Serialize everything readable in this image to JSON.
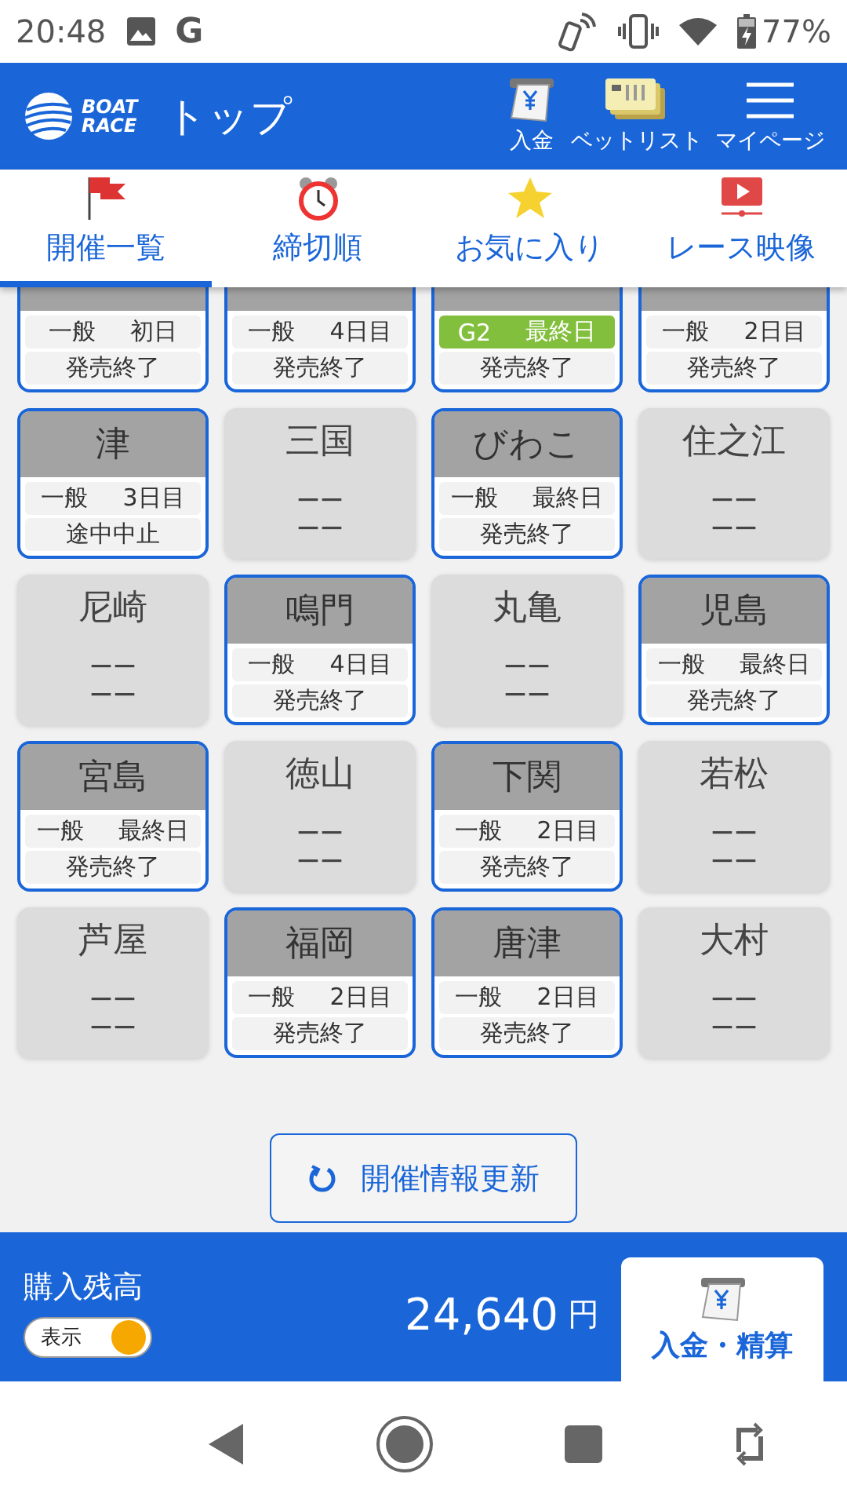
{
  "status_bar": {
    "time": "20:48",
    "app_letter": "G",
    "battery": "77%"
  },
  "header": {
    "logo": [
      "BOAT",
      "RACE"
    ],
    "title": "トップ",
    "actions": [
      {
        "kind": "deposit",
        "label": "入金"
      },
      {
        "kind": "betlist",
        "label": "ベットリスト"
      },
      {
        "kind": "menu",
        "label": "マイページ"
      }
    ]
  },
  "tabs": [
    {
      "kind": "flag",
      "label": "開催一覧",
      "selected": true
    },
    {
      "kind": "clock",
      "label": "締切順",
      "selected": false
    },
    {
      "kind": "star",
      "label": "お気に入り",
      "selected": false
    },
    {
      "kind": "video",
      "label": "レース映像",
      "selected": false
    }
  ],
  "venues": [
    {
      "kind": "open",
      "grade": "一般",
      "day": "初日",
      "status": "発売終了",
      "highlight": false
    },
    {
      "kind": "open",
      "grade": "一般",
      "day": "4日目",
      "status": "発売終了",
      "highlight": false
    },
    {
      "kind": "open",
      "grade": "G2",
      "day": "最終日",
      "status": "発売終了",
      "highlight": true
    },
    {
      "kind": "open",
      "grade": "一般",
      "day": "2日目",
      "status": "発売終了",
      "highlight": false
    },
    {
      "kind": "open",
      "name": "津",
      "grade": "一般",
      "day": "3日目",
      "status": "途中中止",
      "highlight": false
    },
    {
      "kind": "closed",
      "name": "三国",
      "lines": [
        "ーー",
        "ーー"
      ]
    },
    {
      "kind": "open",
      "name": "びわこ",
      "grade": "一般",
      "day": "最終日",
      "status": "発売終了",
      "highlight": false
    },
    {
      "kind": "closed",
      "name": "住之江",
      "lines": [
        "ーー",
        "ーー"
      ]
    },
    {
      "kind": "closed",
      "name": "尼崎",
      "lines": [
        "ーー",
        "ーー"
      ]
    },
    {
      "kind": "open",
      "name": "鳴門",
      "grade": "一般",
      "day": "4日目",
      "status": "発売終了",
      "highlight": false
    },
    {
      "kind": "closed",
      "name": "丸亀",
      "lines": [
        "ーー",
        "ーー"
      ]
    },
    {
      "kind": "open",
      "name": "児島",
      "grade": "一般",
      "day": "最終日",
      "status": "発売終了",
      "highlight": false
    },
    {
      "kind": "open",
      "name": "宮島",
      "grade": "一般",
      "day": "最終日",
      "status": "発売終了",
      "highlight": false
    },
    {
      "kind": "closed",
      "name": "徳山",
      "lines": [
        "ーー",
        "ーー"
      ]
    },
    {
      "kind": "open",
      "name": "下関",
      "grade": "一般",
      "day": "2日目",
      "status": "発売終了",
      "highlight": false
    },
    {
      "kind": "closed",
      "name": "若松",
      "lines": [
        "ーー",
        "ーー"
      ]
    },
    {
      "kind": "closed",
      "name": "芦屋",
      "lines": [
        "ーー",
        "ーー"
      ]
    },
    {
      "kind": "open",
      "name": "福岡",
      "grade": "一般",
      "day": "2日目",
      "status": "発売終了",
      "highlight": false
    },
    {
      "kind": "open",
      "name": "唐津",
      "grade": "一般",
      "day": "2日目",
      "status": "発売終了",
      "highlight": false
    },
    {
      "kind": "closed",
      "name": "大村",
      "lines": [
        "ーー",
        "ーー"
      ]
    }
  ],
  "refresh_button": "開催情報更新",
  "balance": {
    "label": "購入残高",
    "toggle": {
      "label": "表示",
      "on": true
    },
    "amount": "24,640",
    "unit": "円",
    "button": "入金・精算"
  }
}
